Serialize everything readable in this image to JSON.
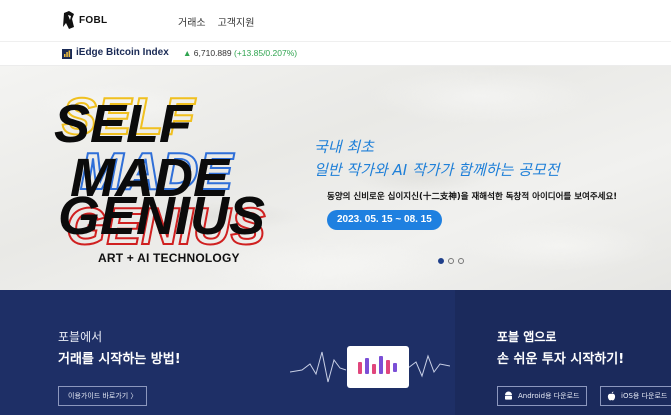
{
  "header": {
    "logo_text": "FOBL",
    "nav": [
      {
        "label": "거래소"
      },
      {
        "label": "고객지원"
      }
    ]
  },
  "ticker": {
    "name": "iEdge Bitcoin Index",
    "arrow": "▲",
    "value": "6,710.889",
    "change": "(+13.85/0.207%)",
    "icon": "index-chart-icon",
    "up_color": "#2fa44f"
  },
  "hero": {
    "art_words": [
      "SELF",
      "MADE",
      "GENIUS"
    ],
    "art_subtitle": "ART + AI TECHNOLOGY",
    "headline_line1": "국내 최초",
    "headline_line2": "일반 작가와 AI 작가가 함께하는 공모전",
    "description": "동양의 신비로운 십이지신(十二支神)을 재해석한 독창적 아이디어를 보여주세요!",
    "date_range": "2023. 05. 15 ~ 08. 15",
    "slide_count": 3,
    "active_slide": 1,
    "accent_color": "#1e7fd8"
  },
  "guide": {
    "title_line1": "포블에서",
    "title_line2": "거래를 시작하는 방법!",
    "button_label": "이용가이드 바로가기  〉",
    "icon": "candlestick-chart-icon"
  },
  "app": {
    "title_line1": "포블 앱으로",
    "title_line2": "손 쉬운 투자 시작하기!",
    "android_label": "Android용 다운로드",
    "ios_label": "iOS용 다운로드",
    "android_icon": "android-icon",
    "ios_icon": "apple-icon"
  },
  "colors": {
    "navy": "#1e2f66",
    "accent_blue": "#1f80e0"
  }
}
